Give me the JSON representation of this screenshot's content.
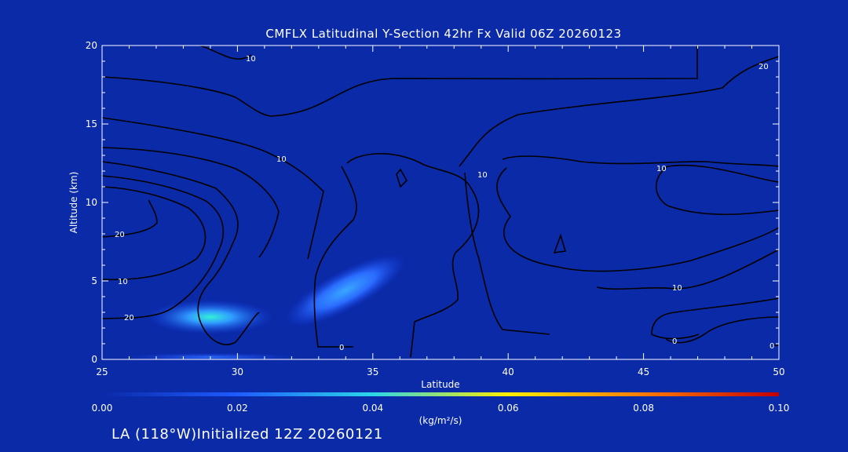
{
  "chart_data": {
    "type": "heatmap",
    "title": "CMFLX Latitudinal Y-Section 42hr  Fx Valid 06Z 20260123",
    "xlabel": "Latitude",
    "ylabel": "Altitude (km)",
    "xlim": [
      25,
      50
    ],
    "ylim": [
      0,
      20
    ],
    "x_ticks": [
      25,
      30,
      35,
      40,
      45,
      50
    ],
    "y_ticks": [
      0,
      5,
      10,
      15,
      20
    ],
    "colorbar": {
      "label": "(kg/m²/s)",
      "range": [
        0.0,
        0.1
      ],
      "ticks": [
        "0.00",
        "0.02",
        "0.04",
        "0.06",
        "0.08",
        "0.10"
      ]
    },
    "convective_flux_maxima": [
      {
        "lat": 29.8,
        "alt_km": 2.9,
        "value": 0.035
      },
      {
        "lat": 34.0,
        "alt_km": 3.6,
        "value": 0.025
      },
      {
        "lat": 30.0,
        "alt_km": 0.0,
        "value": 0.01
      }
    ],
    "contour_labels": [
      "10",
      "20",
      "10",
      "20",
      "10",
      "0",
      "10",
      "20",
      "10",
      "0",
      "10",
      "0"
    ],
    "grid": false,
    "legend": "colorbar-bottom"
  },
  "footer_text": "LA (118°W)Initialized 12Z 20260121"
}
